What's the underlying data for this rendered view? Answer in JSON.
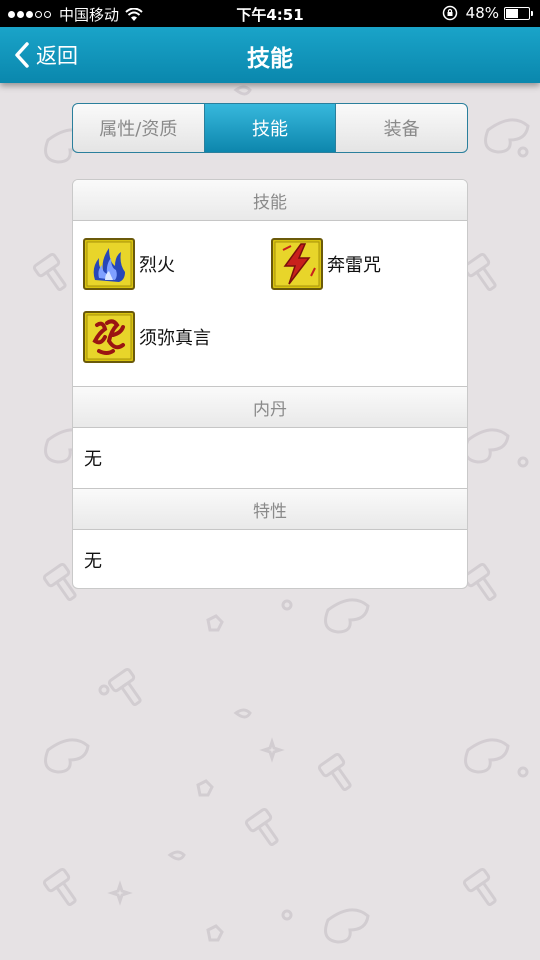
{
  "status_bar": {
    "carrier": "中国移动",
    "time": "下午4:51",
    "battery_percent": "48%",
    "battery_level": 0.48,
    "signal_bars_filled": 3,
    "signal_bars_total": 5,
    "icons": [
      "wifi-icon",
      "orientation-lock-icon",
      "battery-icon"
    ]
  },
  "nav": {
    "back_label": "返回",
    "title": "技能",
    "color": "#0f93bb"
  },
  "tabs": [
    {
      "label": "属性/资质",
      "active": false
    },
    {
      "label": "技能",
      "active": true
    },
    {
      "label": "装备",
      "active": false
    }
  ],
  "sections": {
    "skills": {
      "header": "技能",
      "items": [
        {
          "name": "烈火",
          "icon": "blue-flame-icon"
        },
        {
          "name": "奔雷咒",
          "icon": "lightning-icon"
        },
        {
          "name": "须弥真言",
          "icon": "red-rune-icon"
        }
      ]
    },
    "inner_pill": {
      "header": "内丹",
      "value": "无"
    },
    "traits": {
      "header": "特性",
      "value": "无"
    }
  }
}
